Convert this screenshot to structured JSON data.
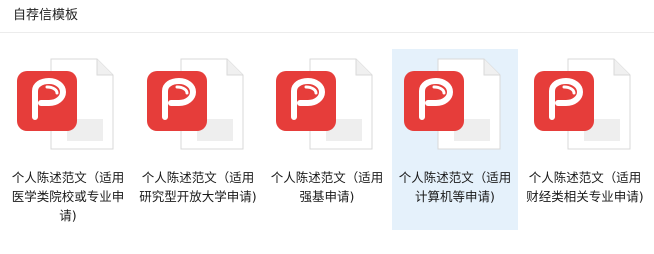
{
  "folder": {
    "title": "自荐信模板"
  },
  "files": [
    {
      "name": "个人陈述范文（适用医学类院校或专业申请)",
      "icon": "wps-pdf-icon",
      "selected": false
    },
    {
      "name": "个人陈述范文（适用研究型开放大学申请)",
      "icon": "wps-pdf-icon",
      "selected": false
    },
    {
      "name": "个人陈述范文（适用强基申请)",
      "icon": "wps-pdf-icon",
      "selected": false
    },
    {
      "name": "个人陈述范文（适用计算机等申请)",
      "icon": "wps-pdf-icon",
      "selected": true
    },
    {
      "name": "个人陈述范文（适用财经类相关专业申请)",
      "icon": "wps-pdf-icon",
      "selected": false
    }
  ],
  "colors": {
    "icon_red": "#e63d3a",
    "selection_bg": "#e5f1fb",
    "page_gray": "#eeeeee"
  }
}
